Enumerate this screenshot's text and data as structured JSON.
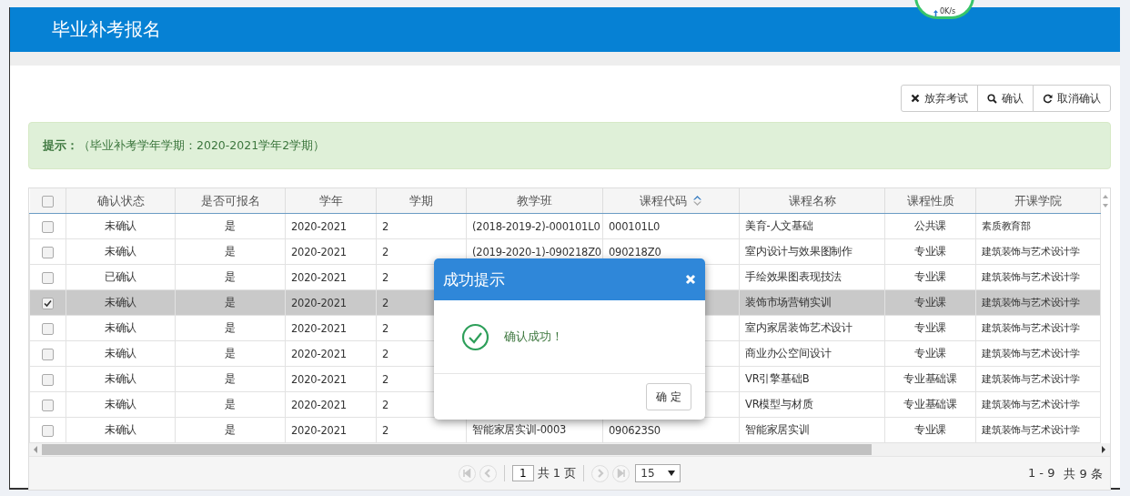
{
  "header": {
    "title": "毕业补考报名"
  },
  "net_widget": {
    "speed": "0K/s"
  },
  "toolbar": {
    "buttons": [
      {
        "label": "放弃考试"
      },
      {
        "label": "确认"
      },
      {
        "label": "取消确认"
      }
    ]
  },
  "alert": {
    "text": "**提示：**（毕业补考学年学期：2020-2021学年2学期）"
  },
  "table": {
    "select_all_checked": false,
    "columns": [
      {
        "label": "确认状态",
        "sortable": false
      },
      {
        "label": "是否可报名",
        "sortable": false
      },
      {
        "label": "学年",
        "sortable": false
      },
      {
        "label": "学期",
        "sortable": false
      },
      {
        "label": "教学班",
        "sortable": false
      },
      {
        "label": "课程代码",
        "sortable": true
      },
      {
        "label": "课程名称",
        "sortable": false
      },
      {
        "label": "课程性质",
        "sortable": false
      },
      {
        "label": "开课学院",
        "sortable": false
      }
    ],
    "rows": [
      {
        "checked": false,
        "cells": [
          "未确认",
          "是",
          "2020-2021",
          "2",
          "(2018-2019-2)-000101L0",
          "000101L0",
          "美育-人文基础",
          "公共课",
          "素质教育部"
        ]
      },
      {
        "checked": false,
        "cells": [
          "未确认",
          "是",
          "2020-2021",
          "2",
          "(2019-2020-1)-090218Z0",
          "090218Z0",
          "室内设计与效果图制作",
          "专业课",
          "建筑装饰与艺术设计学"
        ]
      },
      {
        "checked": false,
        "cells": [
          "已确认",
          "是",
          "2020-2021",
          "2",
          null,
          null,
          "手绘效果图表现技法",
          "专业课",
          "建筑装饰与艺术设计学"
        ]
      },
      {
        "checked": true,
        "cells": [
          "未确认",
          "是",
          "2020-2021",
          "2",
          null,
          null,
          "装饰市场营销实训",
          "专业课",
          "建筑装饰与艺术设计学"
        ]
      },
      {
        "checked": false,
        "cells": [
          "未确认",
          "是",
          "2020-2021",
          "2",
          null,
          null,
          "室内家居装饰艺术设计",
          "专业课",
          "建筑装饰与艺术设计学"
        ]
      },
      {
        "checked": false,
        "cells": [
          "未确认",
          "是",
          "2020-2021",
          "2",
          null,
          null,
          "商业办公空间设计",
          "专业课",
          "建筑装饰与艺术设计学"
        ]
      },
      {
        "checked": false,
        "cells": [
          "未确认",
          "是",
          "2020-2021",
          "2",
          null,
          null,
          "VR引擎基础B",
          "专业基础课",
          "建筑装饰与艺术设计学"
        ]
      },
      {
        "checked": false,
        "cells": [
          "未确认",
          "是",
          "2020-2021",
          "2",
          null,
          null,
          "VR模型与材质",
          "专业基础课",
          "建筑装饰与艺术设计学"
        ]
      },
      {
        "checked": false,
        "cells": [
          "未确认",
          "是",
          "2020-2021",
          "2",
          "智能家居实训-0003",
          "090623S0",
          "智能家居实训",
          "专业课",
          "建筑装饰与艺术设计学"
        ]
      }
    ]
  },
  "pager": {
    "nav": [
      {
        "kind": "first",
        "disabled": true
      },
      {
        "kind": "prev",
        "disabled": true
      },
      {
        "kind": "next",
        "disabled": true
      },
      {
        "kind": "last",
        "disabled": true
      }
    ],
    "page": "1",
    "pages_text": "共 1 页",
    "page_size": "15",
    "range": "1 - 9",
    "total": "共 9 条"
  },
  "dialog": {
    "title": "成功提示",
    "message": "确认成功！",
    "button": "确 定"
  }
}
